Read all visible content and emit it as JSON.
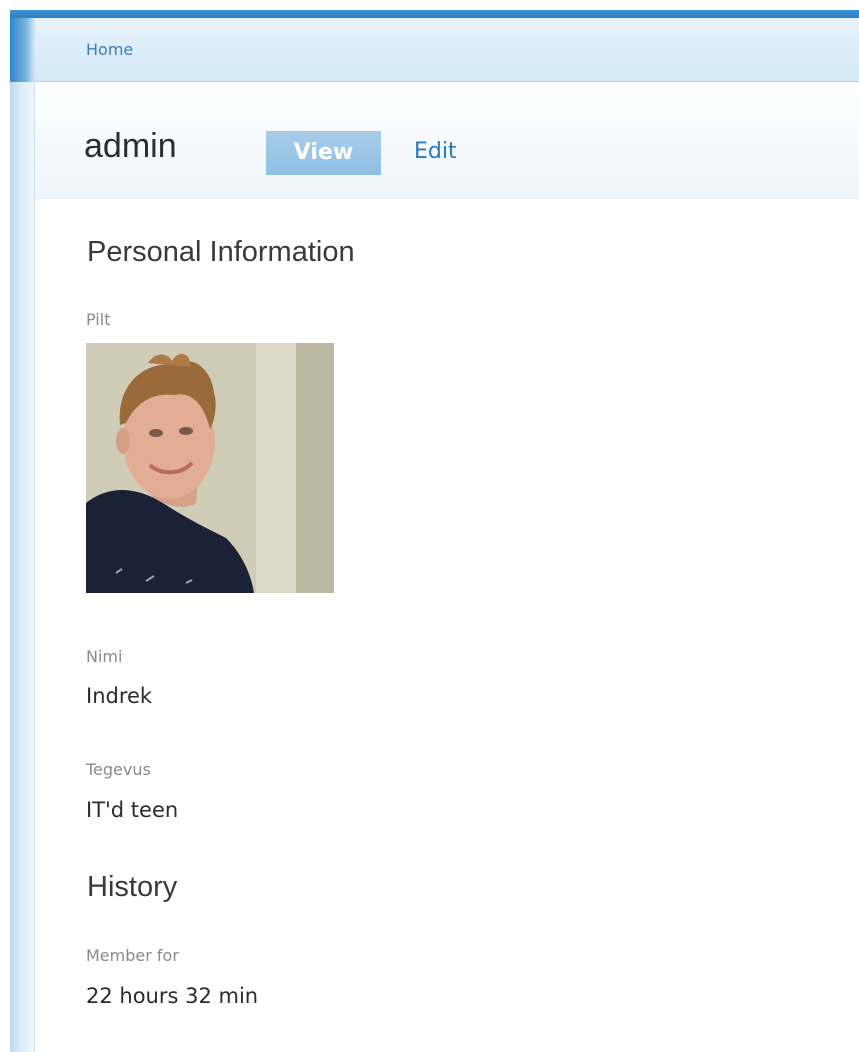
{
  "breadcrumb": {
    "home_label": "Home"
  },
  "header": {
    "title": "admin",
    "tabs": [
      {
        "label": "View",
        "active": true
      },
      {
        "label": "Edit",
        "active": false
      }
    ]
  },
  "personal_info": {
    "heading": "Personal Information",
    "picture_label": "Pilt",
    "name_label": "Nimi",
    "name_value": "Indrek",
    "occupation_label": "Tegevus",
    "occupation_value": "IT'd teen"
  },
  "history": {
    "heading": "History",
    "member_for_label": "Member for",
    "member_for_value": "22 hours 32 min"
  },
  "colors": {
    "accent": "#2b7fc2",
    "link": "#2a78c0",
    "active_tab_bg": "#9cc7e6"
  }
}
